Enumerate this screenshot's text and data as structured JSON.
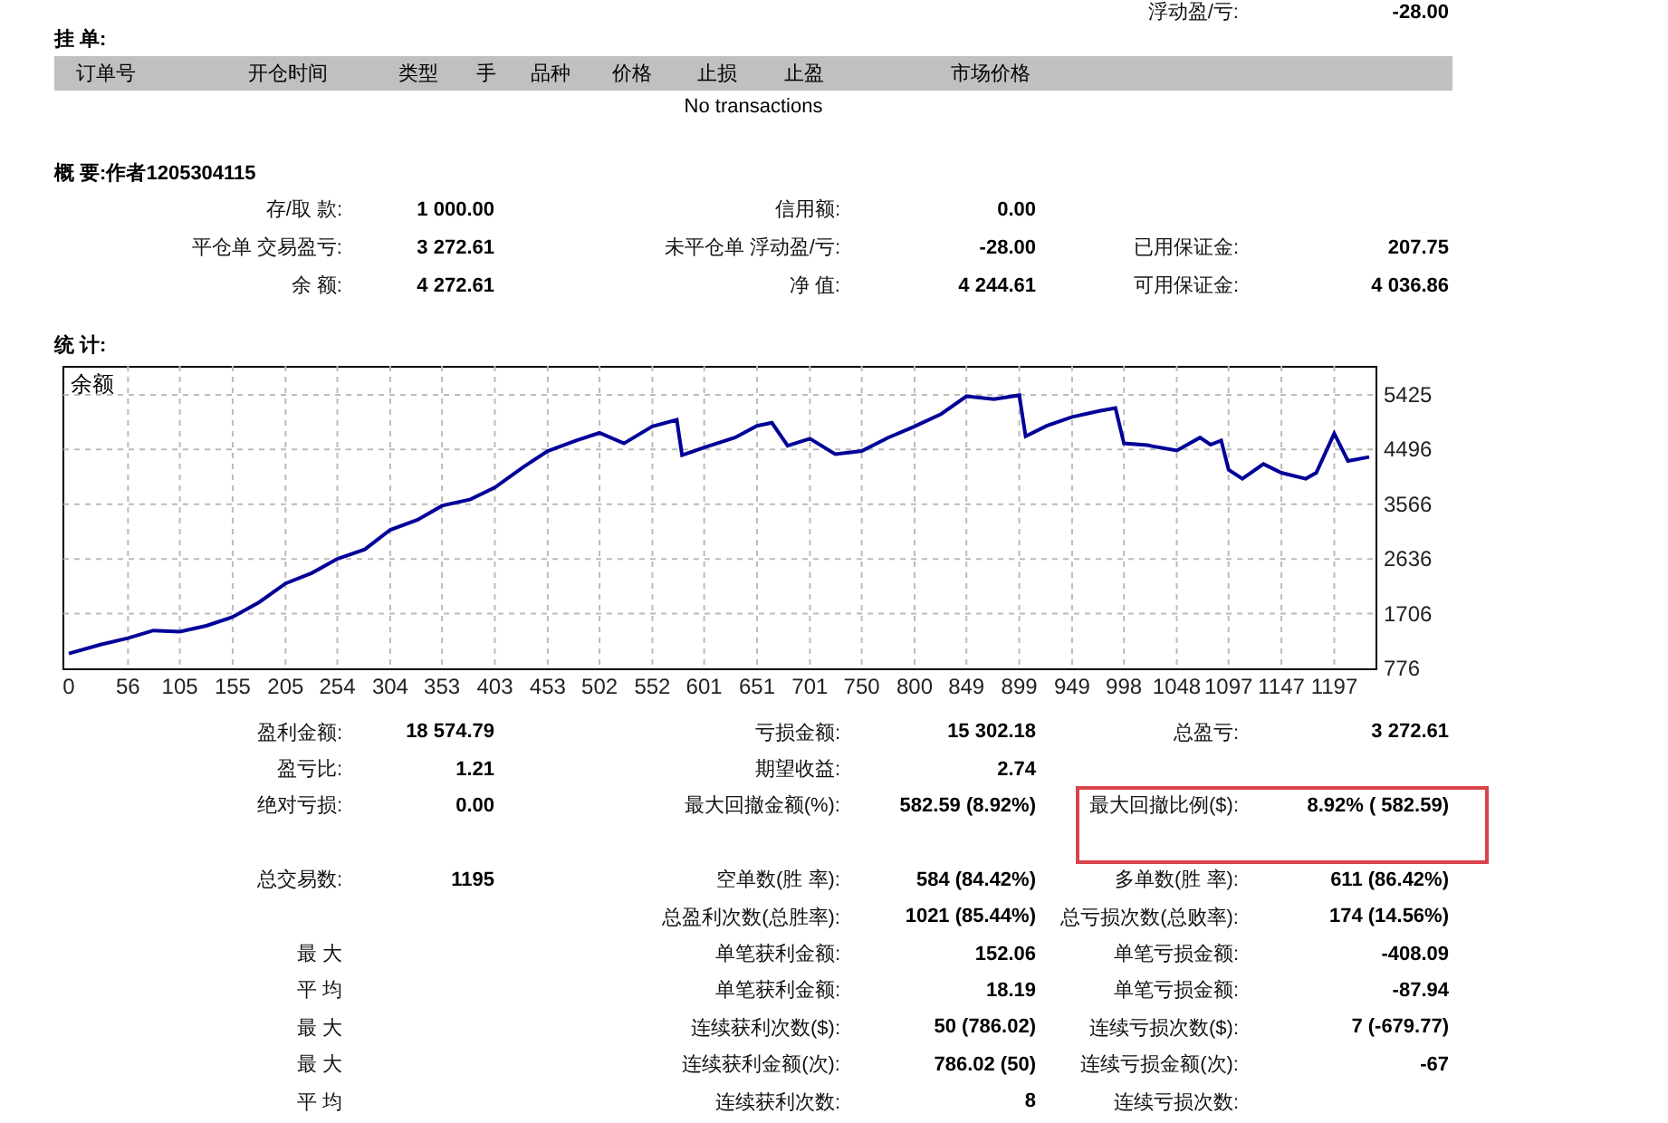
{
  "top_cut_row": {
    "label": "浮动盈/亏:",
    "value": "-28.00"
  },
  "pending_orders": {
    "title": "挂 单:",
    "columns": [
      "订单号",
      "开仓时间",
      "类型",
      "手",
      "品种",
      "价格",
      "止损",
      "止盈",
      "市场价格"
    ],
    "empty_message": "No transactions"
  },
  "summary": {
    "title": "概 要:作者1205304115",
    "rows": [
      [
        {
          "label": "存/取 款:",
          "value": "1 000.00"
        },
        {
          "label": "信用额:",
          "value": "0.00"
        }
      ],
      [
        {
          "label": "平仓单 交易盈亏:",
          "value": "3 272.61"
        },
        {
          "label": "未平仓单 浮动盈/亏:",
          "value": "-28.00"
        },
        {
          "label": "已用保证金:",
          "value": "207.75"
        }
      ],
      [
        {
          "label": "余 额:",
          "value": "4 272.61"
        },
        {
          "label": "净 值:",
          "value": "4 244.61"
        },
        {
          "label": "可用保证金:",
          "value": "4 036.86"
        }
      ]
    ]
  },
  "statistics": {
    "title": "统 计:",
    "chart_data": {
      "type": "line",
      "title": "余额",
      "grid": true,
      "xlim": [
        0,
        1230
      ],
      "ylim": [
        776,
        5918
      ],
      "xticks": [
        0,
        56,
        105,
        155,
        205,
        254,
        304,
        353,
        403,
        453,
        502,
        552,
        601,
        651,
        701,
        750,
        800,
        849,
        899,
        949,
        998,
        1048,
        1097,
        1147,
        1197
      ],
      "yticks": [
        776,
        1706,
        2636,
        3566,
        4496,
        5425
      ],
      "x": [
        0,
        30,
        56,
        80,
        105,
        130,
        155,
        180,
        205,
        230,
        254,
        280,
        304,
        330,
        353,
        380,
        403,
        430,
        453,
        480,
        502,
        525,
        552,
        575,
        580,
        601,
        630,
        651,
        665,
        680,
        701,
        725,
        750,
        775,
        800,
        825,
        849,
        875,
        899,
        905,
        925,
        949,
        975,
        990,
        998,
        1020,
        1048,
        1070,
        1080,
        1090,
        1097,
        1110,
        1130,
        1147,
        1170,
        1180,
        1197,
        1210,
        1230
      ],
      "series": [
        {
          "color": "#000099",
          "values": [
            1030,
            1180,
            1290,
            1420,
            1400,
            1500,
            1650,
            1900,
            2220,
            2400,
            2640,
            2800,
            3130,
            3300,
            3540,
            3650,
            3850,
            4200,
            4470,
            4650,
            4780,
            4600,
            4890,
            5000,
            4400,
            4530,
            4700,
            4900,
            4950,
            4560,
            4680,
            4420,
            4470,
            4700,
            4890,
            5100,
            5400,
            5350,
            5420,
            4720,
            4900,
            5050,
            5150,
            5200,
            4600,
            4570,
            4480,
            4700,
            4580,
            4650,
            4150,
            4000,
            4250,
            4100,
            4000,
            4100,
            4770,
            4300,
            4370
          ]
        }
      ]
    },
    "groups": [
      [
        [
          {
            "label": "盈利金额:",
            "value": "18 574.79"
          },
          {
            "label": "亏损金额:",
            "value": "15 302.18"
          },
          {
            "label": "总盈亏:",
            "value": "3 272.61"
          }
        ],
        [
          {
            "label": "盈亏比:",
            "value": "1.21"
          },
          {
            "label": "期望收益:",
            "value": "2.74"
          }
        ],
        [
          {
            "label": "绝对亏损:",
            "value": "0.00"
          },
          {
            "label": "最大回撤金额(%):",
            "value": "582.59 (8.92%)"
          },
          {
            "label": "最大回撤比例($):",
            "value": "8.92% ( 582.59)",
            "highlighted": true
          }
        ]
      ],
      [
        [
          {
            "label": "总交易数:",
            "value": "1195"
          },
          {
            "label": "空单数(胜 率):",
            "value": "584 (84.42%)"
          },
          {
            "label": "多单数(胜 率):",
            "value": "611 (86.42%)"
          }
        ],
        [
          {
            "label": "总盈利次数(总胜率):",
            "value": "1021 (85.44%)"
          },
          {
            "label": "总亏损次数(总败率):",
            "value": "174 (14.56%)",
            "kind": "shifted"
          }
        ],
        [
          {
            "label": "最 大"
          },
          {
            "label": "单笔获利金额:",
            "value": "152.06"
          },
          {
            "label": "单笔亏损金额:",
            "value": "-408.09"
          }
        ],
        [
          {
            "label": "平 均"
          },
          {
            "label": "单笔获利金额:",
            "value": "18.19"
          },
          {
            "label": "单笔亏损金额:",
            "value": "-87.94"
          }
        ],
        [
          {
            "label": "最 大"
          },
          {
            "label": "连续获利次数($):",
            "value": "50 (786.02)"
          },
          {
            "label": "连续亏损次数($):",
            "value": "7 (-679.77)"
          }
        ],
        [
          {
            "label": "最 大"
          },
          {
            "label": "连续获利金额(次):",
            "value": "786.02 (50)"
          },
          {
            "label": "连续亏损金额(次):",
            "value": "-67"
          }
        ],
        [
          {
            "label": "平 均"
          },
          {
            "label": "连续获利次数:",
            "value": "8"
          },
          {
            "label": "连续亏损次数:"
          }
        ]
      ]
    ]
  }
}
